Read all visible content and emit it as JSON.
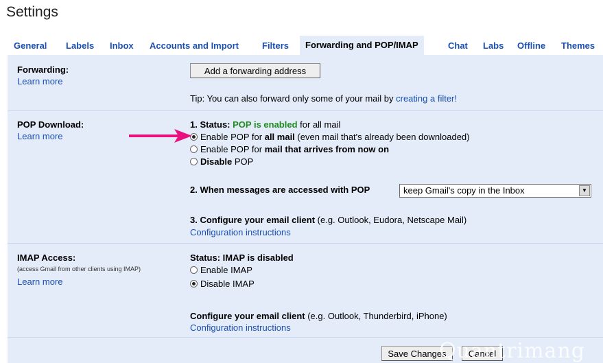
{
  "page": {
    "title": "Settings"
  },
  "tabs": [
    {
      "label": "General"
    },
    {
      "label": "Labels"
    },
    {
      "label": "Inbox"
    },
    {
      "label": "Accounts and Import"
    },
    {
      "label": "Filters"
    },
    {
      "label": "Forwarding and POP/IMAP"
    },
    {
      "label": "Chat"
    },
    {
      "label": "Labs"
    },
    {
      "label": "Offline"
    },
    {
      "label": "Themes"
    }
  ],
  "forwarding": {
    "label": "Forwarding:",
    "learn_more": "Learn more",
    "add_button": "Add a forwarding address",
    "tip_prefix": "Tip: You can also forward only some of your mail by ",
    "tip_link": "creating a filter!"
  },
  "pop": {
    "label": "POP Download:",
    "learn_more": "Learn more",
    "status_prefix": "1. Status: ",
    "status_value": "POP is enabled",
    "status_suffix": " for all mail",
    "option_all_pre": "Enable POP for ",
    "option_all_bold": "all mail",
    "option_all_post": " (even mail that's already been downloaded)",
    "option_new_pre": "Enable POP for ",
    "option_new_bold": "mail that arrives from now on",
    "option_disable_bold": "Disable",
    "option_disable_post": " POP",
    "accessed_label": "2. When messages are accessed with POP",
    "accessed_value": "keep Gmail's copy in the Inbox",
    "configure_bold": "3. Configure your email client",
    "configure_rest": " (e.g. Outlook, Eudora, Netscape Mail)",
    "config_link": "Configuration instructions"
  },
  "imap": {
    "label": "IMAP Access:",
    "sublabel": "(access Gmail from other clients using IMAP)",
    "learn_more": "Learn more",
    "status": "Status: IMAP is disabled",
    "enable": "Enable IMAP",
    "disable": "Disable IMAP",
    "configure_bold": "Configure your email client",
    "configure_rest": " (e.g. Outlook, Thunderbird, iPhone)",
    "config_link": "Configuration instructions"
  },
  "footer": {
    "save": "Save Changes",
    "cancel": "Cancel"
  },
  "watermark": "Quantrimang",
  "colors": {
    "tab_link": "#1a4fb3",
    "panel_bg": "#e4ecf9",
    "status_green": "#1e8c1e",
    "arrow": "#e8127e"
  }
}
